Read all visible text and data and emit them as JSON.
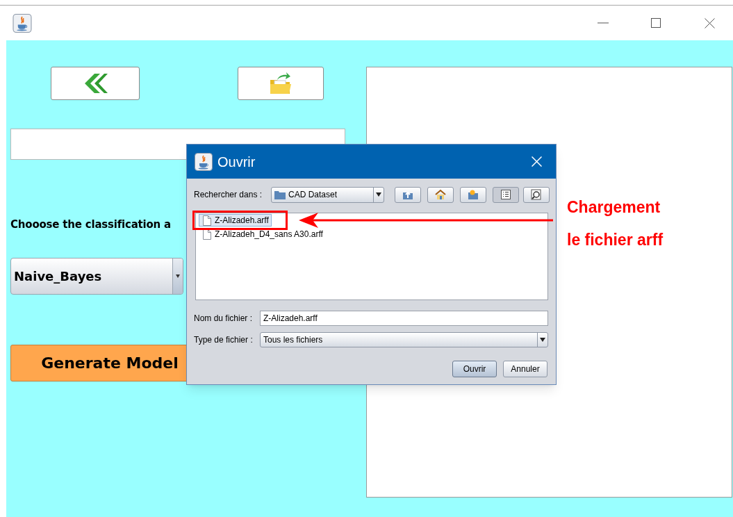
{
  "main": {
    "label": "Chooose the classification a",
    "algorithm": {
      "value": "Naive_Bayes"
    },
    "generate_button": "Generate Model"
  },
  "dialog": {
    "title": "Ouvrir",
    "look_in_label": "Rechercher dans :",
    "look_in_value": "CAD Dataset",
    "toolbar": [
      {
        "kind": "up",
        "selected": false
      },
      {
        "kind": "home",
        "selected": false
      },
      {
        "kind": "new-folder",
        "selected": false
      },
      {
        "kind": "list",
        "selected": true
      },
      {
        "kind": "details",
        "selected": false
      }
    ],
    "files": [
      {
        "name": "Z-Alizadeh.arff",
        "selected": true
      },
      {
        "name": "Z-Alizadeh_D4_sans A30.arff",
        "selected": false
      }
    ],
    "filename_label": "Nom du fichier :",
    "filename_value": "Z-Alizadeh.arff",
    "filetype_label": "Type de fichier :",
    "filetype_value": "Tous les fichiers",
    "buttons": [
      "Ouvrir",
      "Annuler"
    ]
  },
  "annotation": {
    "lines": [
      "Chargement",
      "le fichier arff"
    ]
  }
}
